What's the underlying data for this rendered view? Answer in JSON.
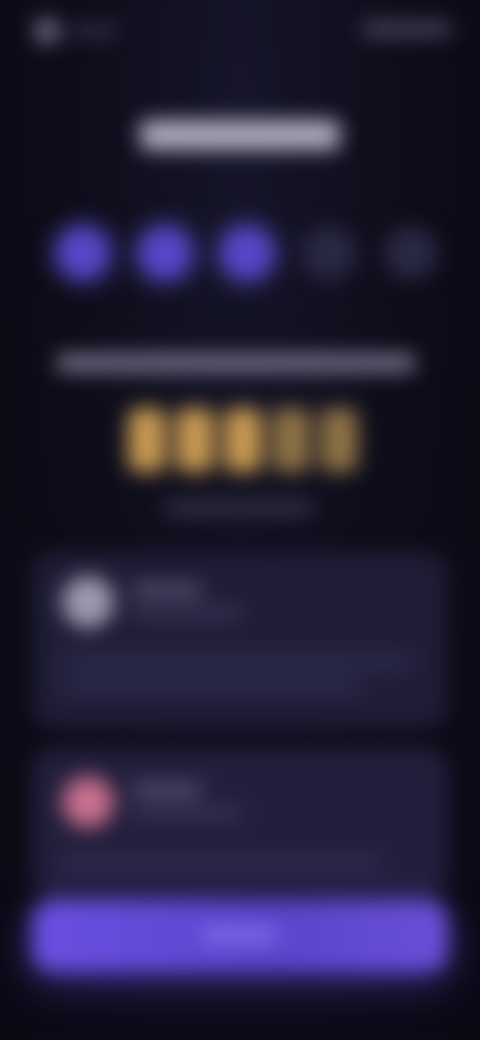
{
  "screen": {
    "background": "#0d0c18",
    "accent": "#5a45cc",
    "gold": "#c89a52"
  },
  "header": {
    "logo_icon": "app-logo-icon"
  },
  "progress": {
    "total_steps": 5,
    "completed_steps": 3
  },
  "rating": {
    "filled_stars": 3,
    "total_stars": 5
  }
}
